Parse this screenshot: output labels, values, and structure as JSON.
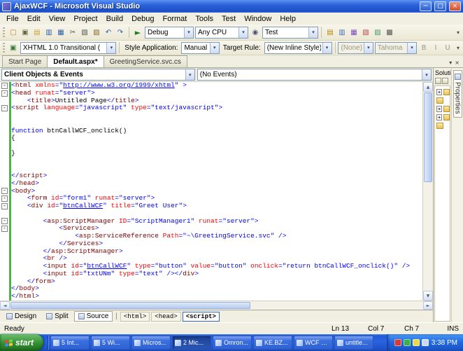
{
  "glyphs": {
    "chevron_down": "▾",
    "close": "×",
    "minimize": "─",
    "maximize": "□",
    "play": "►",
    "up": "▲",
    "down": "▼",
    "left": "◄",
    "right": "►",
    "minus": "-",
    "plus": "+",
    "pipe": "|"
  },
  "window": {
    "title": "AjaxWCF - Microsoft Visual Studio"
  },
  "menu": {
    "items": [
      "File",
      "Edit",
      "View",
      "Project",
      "Build",
      "Debug",
      "Format",
      "Tools",
      "Test",
      "Window",
      "Help"
    ]
  },
  "toolbar1": {
    "left_icons": [
      {
        "name": "new-website-icon",
        "glyph": "▢",
        "color": "#c87818"
      },
      {
        "name": "add-new-item-icon",
        "glyph": "▣",
        "color": "#6b6b3a"
      },
      {
        "name": "open-file-icon",
        "glyph": "▤",
        "color": "#caa52a"
      },
      {
        "name": "save-icon",
        "glyph": "▥",
        "color": "#2f5fa8"
      },
      {
        "name": "save-all-icon",
        "glyph": "▦",
        "color": "#2f5fa8"
      },
      {
        "name": "cut-icon",
        "glyph": "✂",
        "color": "#555555"
      },
      {
        "name": "copy-icon",
        "glyph": "▧",
        "color": "#555555"
      },
      {
        "name": "paste-icon",
        "glyph": "▨",
        "color": "#8a6a2a"
      },
      {
        "name": "undo-icon",
        "glyph": "↶",
        "color": "#2f5fa8"
      },
      {
        "name": "redo-icon",
        "glyph": "↷",
        "color": "#2f5fa8"
      }
    ],
    "debug": "Debug",
    "platform": "Any CPU",
    "mid_icons": [
      {
        "name": "find-in-files-icon",
        "glyph": "◉",
        "color": "#44547a"
      }
    ],
    "search": "Test",
    "right_icons": [
      {
        "name": "solution-explorer-icon",
        "glyph": "▤",
        "color": "#b8860b"
      },
      {
        "name": "properties-window-icon",
        "glyph": "▥",
        "color": "#4a6fb8"
      },
      {
        "name": "object-browser-icon",
        "glyph": "▦",
        "color": "#7a4ab8"
      },
      {
        "name": "toolbox-icon",
        "glyph": "▧",
        "color": "#b84a4a"
      },
      {
        "name": "error-list-icon",
        "glyph": "▨",
        "color": "#4a9a6a"
      },
      {
        "name": "command-window-icon",
        "glyph": "▩",
        "color": "#555555"
      }
    ]
  },
  "toolbar2": {
    "leading_icons": [
      {
        "name": "format-selection-icon",
        "glyph": "▣",
        "color": "#3a7a3a"
      }
    ],
    "validation_target": "XHTML 1.0 Transitional (",
    "style_application_label": "Style Application:",
    "style_application": "Manual",
    "target_rule_label": "Target Rule:",
    "target_rule": "(New Inline Style)",
    "css_class": "(None)",
    "font_name": "Tahoma",
    "trailing_icons": [
      {
        "name": "bold-icon",
        "glyph": "B",
        "color": "#9a9784",
        "disabled": true
      },
      {
        "name": "italic-icon",
        "glyph": "I",
        "color": "#9a9784",
        "disabled": true
      },
      {
        "name": "underline-icon",
        "glyph": "U",
        "color": "#9a9784",
        "disabled": true
      }
    ]
  },
  "tabs": [
    {
      "label": "Start Page",
      "active": false
    },
    {
      "label": "Default.aspx*",
      "active": true
    },
    {
      "label": "GreetingService.svc.cs",
      "active": false
    }
  ],
  "navbar": {
    "objects": "Client Objects & Events",
    "events": "(No Events)"
  },
  "editor": {
    "lines": [
      {
        "f": 1,
        "s": [
          [
            "d",
            "<"
          ],
          [
            "t",
            "html"
          ],
          [
            "p",
            " "
          ],
          [
            "a",
            "xmlns"
          ],
          [
            "d",
            "="
          ],
          [
            "v",
            "\""
          ],
          [
            "u",
            "http://www.w3.org/1999/xhtml"
          ],
          [
            "v",
            "\""
          ],
          [
            "p",
            " "
          ],
          [
            "d",
            ">"
          ]
        ]
      },
      {
        "f": 1,
        "s": [
          [
            "d",
            "<"
          ],
          [
            "t",
            "head"
          ],
          [
            "p",
            " "
          ],
          [
            "a",
            "runat"
          ],
          [
            "d",
            "="
          ],
          [
            "v",
            "\"server\""
          ],
          [
            "d",
            ">"
          ]
        ]
      },
      {
        "f": 0,
        "s": [
          [
            "p",
            "    "
          ],
          [
            "d",
            "<"
          ],
          [
            "t",
            "title"
          ],
          [
            "d",
            ">"
          ],
          [
            "p",
            "Untitled Page"
          ],
          [
            "d",
            "</"
          ],
          [
            "t",
            "title"
          ],
          [
            "d",
            ">"
          ]
        ]
      },
      {
        "f": 1,
        "s": [
          [
            "d",
            "<"
          ],
          [
            "t",
            "script"
          ],
          [
            "p",
            " "
          ],
          [
            "a",
            "language"
          ],
          [
            "d",
            "="
          ],
          [
            "v",
            "\"javascript\""
          ],
          [
            "p",
            " "
          ],
          [
            "a",
            "type"
          ],
          [
            "d",
            "="
          ],
          [
            "v",
            "\"text/javascript\""
          ],
          [
            "d",
            ">"
          ]
        ]
      },
      {
        "f": 0,
        "s": []
      },
      {
        "f": 0,
        "s": []
      },
      {
        "f": 0,
        "s": [
          [
            "k",
            "function"
          ],
          [
            "p",
            " btnCallWCF_onclick()"
          ]
        ]
      },
      {
        "f": 0,
        "s": [
          [
            "p",
            "{"
          ]
        ]
      },
      {
        "f": 0,
        "s": []
      },
      {
        "f": 0,
        "s": [
          [
            "p",
            "}"
          ]
        ]
      },
      {
        "f": 0,
        "s": []
      },
      {
        "f": 0,
        "s": []
      },
      {
        "f": 0,
        "s": [
          [
            "d",
            "</"
          ],
          [
            "t",
            "script"
          ],
          [
            "d",
            ">"
          ]
        ]
      },
      {
        "f": 0,
        "s": [
          [
            "d",
            "</"
          ],
          [
            "t",
            "head"
          ],
          [
            "d",
            ">"
          ]
        ]
      },
      {
        "f": 1,
        "s": [
          [
            "d",
            "<"
          ],
          [
            "t",
            "body"
          ],
          [
            "d",
            ">"
          ]
        ]
      },
      {
        "f": 1,
        "s": [
          [
            "p",
            "    "
          ],
          [
            "d",
            "<"
          ],
          [
            "t",
            "form"
          ],
          [
            "p",
            " "
          ],
          [
            "a",
            "id"
          ],
          [
            "d",
            "="
          ],
          [
            "v",
            "\"form1\""
          ],
          [
            "p",
            " "
          ],
          [
            "a",
            "runat"
          ],
          [
            "d",
            "="
          ],
          [
            "v",
            "\"server\""
          ],
          [
            "d",
            ">"
          ]
        ]
      },
      {
        "f": 1,
        "s": [
          [
            "p",
            "    "
          ],
          [
            "d",
            "<"
          ],
          [
            "t",
            "div"
          ],
          [
            "p",
            " "
          ],
          [
            "a",
            "id"
          ],
          [
            "d",
            "="
          ],
          [
            "v",
            "\""
          ],
          [
            "u",
            "btnCallWCF"
          ],
          [
            "v",
            "\""
          ],
          [
            "p",
            " "
          ],
          [
            "a",
            "title"
          ],
          [
            "d",
            "="
          ],
          [
            "v",
            "\"Greet User\""
          ],
          [
            "d",
            ">"
          ]
        ]
      },
      {
        "f": 0,
        "s": []
      },
      {
        "f": 1,
        "s": [
          [
            "p",
            "        "
          ],
          [
            "d",
            "<"
          ],
          [
            "t",
            "asp:ScriptManager"
          ],
          [
            "p",
            " "
          ],
          [
            "a",
            "ID"
          ],
          [
            "d",
            "="
          ],
          [
            "v",
            "\"ScriptManager1\""
          ],
          [
            "p",
            " "
          ],
          [
            "a",
            "runat"
          ],
          [
            "d",
            "="
          ],
          [
            "v",
            "\"server\""
          ],
          [
            "d",
            ">"
          ]
        ]
      },
      {
        "f": 1,
        "s": [
          [
            "p",
            "            "
          ],
          [
            "d",
            "<"
          ],
          [
            "t",
            "Services"
          ],
          [
            "d",
            ">"
          ]
        ]
      },
      {
        "f": 0,
        "s": [
          [
            "p",
            "                "
          ],
          [
            "d",
            "<"
          ],
          [
            "t",
            "asp:ServiceReference"
          ],
          [
            "p",
            " "
          ],
          [
            "a",
            "Path"
          ],
          [
            "d",
            "="
          ],
          [
            "v",
            "\"~\\GreetingService.svc\""
          ],
          [
            "p",
            " "
          ],
          [
            "d",
            "/>"
          ]
        ]
      },
      {
        "f": 0,
        "s": [
          [
            "p",
            "            "
          ],
          [
            "d",
            "</"
          ],
          [
            "t",
            "Services"
          ],
          [
            "d",
            ">"
          ]
        ]
      },
      {
        "f": 0,
        "s": [
          [
            "p",
            "        "
          ],
          [
            "d",
            "</"
          ],
          [
            "t",
            "asp:ScriptManager"
          ],
          [
            "d",
            ">"
          ]
        ]
      },
      {
        "f": 0,
        "s": [
          [
            "p",
            "        "
          ],
          [
            "d",
            "<"
          ],
          [
            "t",
            "br"
          ],
          [
            "p",
            " "
          ],
          [
            "d",
            "/>"
          ]
        ]
      },
      {
        "f": 0,
        "s": [
          [
            "p",
            "        "
          ],
          [
            "d",
            "<"
          ],
          [
            "t",
            "input"
          ],
          [
            "p",
            " "
          ],
          [
            "a",
            "id"
          ],
          [
            "d",
            "="
          ],
          [
            "v",
            "\""
          ],
          [
            "u",
            "btnCallWCF"
          ],
          [
            "v",
            "\""
          ],
          [
            "p",
            " "
          ],
          [
            "a",
            "type"
          ],
          [
            "d",
            "="
          ],
          [
            "v",
            "\"button\""
          ],
          [
            "p",
            " "
          ],
          [
            "a",
            "value"
          ],
          [
            "d",
            "="
          ],
          [
            "v",
            "\"button\""
          ],
          [
            "p",
            " "
          ],
          [
            "a",
            "onclick"
          ],
          [
            "d",
            "="
          ],
          [
            "v",
            "\"return btnCallWCF_onclick()\""
          ],
          [
            "p",
            " "
          ],
          [
            "d",
            "/>"
          ]
        ]
      },
      {
        "f": 0,
        "s": [
          [
            "p",
            "        "
          ],
          [
            "d",
            "<"
          ],
          [
            "t",
            "input"
          ],
          [
            "p",
            " "
          ],
          [
            "a",
            "id"
          ],
          [
            "d",
            "="
          ],
          [
            "v",
            "\"txtUNm\""
          ],
          [
            "p",
            " "
          ],
          [
            "a",
            "type"
          ],
          [
            "d",
            "="
          ],
          [
            "v",
            "\"text\""
          ],
          [
            "p",
            " "
          ],
          [
            "d",
            "/>"
          ],
          [
            "d",
            "</"
          ],
          [
            "t",
            "div"
          ],
          [
            "d",
            ">"
          ]
        ]
      },
      {
        "f": 0,
        "s": [
          [
            "p",
            "    "
          ],
          [
            "d",
            "</"
          ],
          [
            "t",
            "form"
          ],
          [
            "d",
            ">"
          ]
        ]
      },
      {
        "f": 0,
        "s": [
          [
            "d",
            "</"
          ],
          [
            "t",
            "body"
          ],
          [
            "d",
            ">"
          ]
        ]
      },
      {
        "f": 0,
        "s": [
          [
            "d",
            "</"
          ],
          [
            "t",
            "html"
          ],
          [
            "d",
            ">"
          ]
        ]
      }
    ]
  },
  "viewbar": {
    "design": "Design",
    "split": "Split",
    "source": "Source",
    "tags": [
      {
        "label": "<html>",
        "current": false
      },
      {
        "label": "<head>",
        "current": false
      },
      {
        "label": "<script>",
        "current": true
      }
    ]
  },
  "statusbar": {
    "ready": "Ready",
    "line": "Ln 13",
    "column": "Col 7",
    "character": "Ch 7",
    "mode": "INS"
  },
  "right_panel": {
    "title": "Soluti",
    "properties_tab": "Properties",
    "tree_rows": [
      {
        "plus": true
      },
      {
        "plus": false
      },
      {
        "plus": true
      },
      {
        "plus": true
      },
      {
        "plus": false
      }
    ]
  },
  "taskbar": {
    "start": "start",
    "buttons": [
      {
        "label": "5 Int...",
        "active": false
      },
      {
        "label": "5 Wi...",
        "active": false
      },
      {
        "label": "Micros...",
        "active": false
      },
      {
        "label": "2 Mic...",
        "active": true
      },
      {
        "label": "Omron...",
        "active": false
      },
      {
        "label": "KE.BZ...",
        "active": false
      },
      {
        "label": "WCF S...",
        "active": false
      },
      {
        "label": "untitle...",
        "active": false
      }
    ],
    "tray_icons": [
      {
        "name": "tray-shield-icon",
        "color": "#d43a3a"
      },
      {
        "name": "tray-network-icon",
        "color": "#3ab04a"
      },
      {
        "name": "tray-update-icon",
        "color": "#e8d84a"
      },
      {
        "name": "tray-volume-icon",
        "color": "#cfd8ea"
      }
    ],
    "time": "3:38 PM"
  },
  "colors": {
    "tag": "#800000",
    "attribute": "#ff0000",
    "value": "#0000ff",
    "keyword": "#0000ff",
    "plain": "#000000",
    "change_bar": "#4fb24f"
  }
}
